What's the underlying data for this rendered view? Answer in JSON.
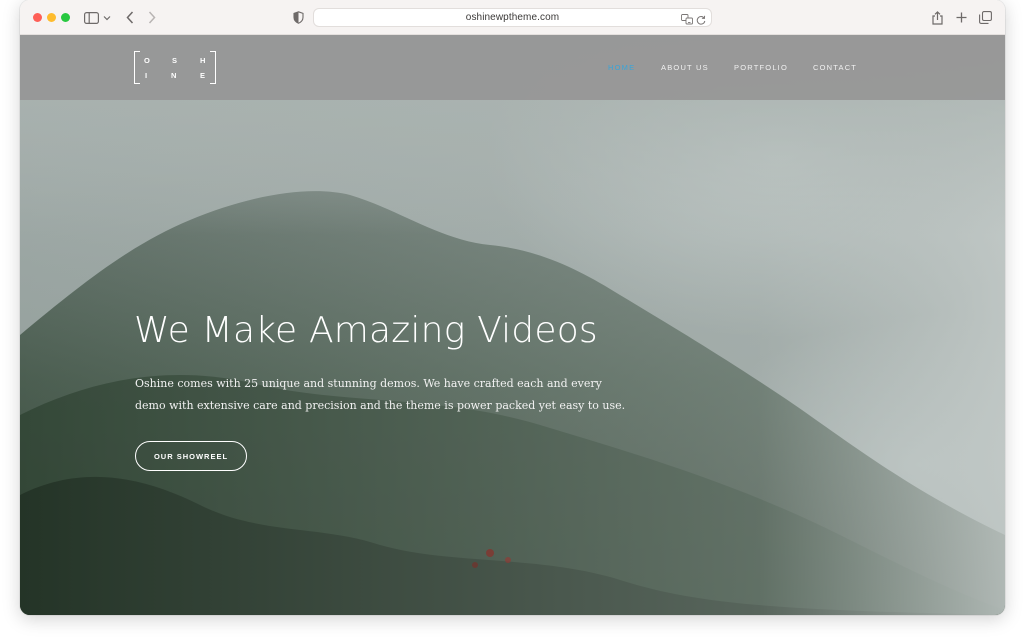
{
  "browser": {
    "url": "oshinewptheme.com"
  },
  "site": {
    "logo": {
      "letters": [
        "O",
        "S",
        "H",
        "I",
        "N",
        "E"
      ]
    },
    "nav": {
      "home": "HOME",
      "about": "ABOUT US",
      "portfolio": "PORTFOLIO",
      "contact": "CONTACT",
      "active": "HOME"
    },
    "hero": {
      "title": "We Make Amazing Videos",
      "text": "Oshine comes with 25 unique and stunning demos. We have crafted each and every demo with extensive care and precision and the theme is power packed yet easy to use.",
      "button": "OUR SHOWREEL"
    }
  },
  "colors": {
    "nav_active": "#3aa4d8",
    "header_bg": "#969696"
  }
}
